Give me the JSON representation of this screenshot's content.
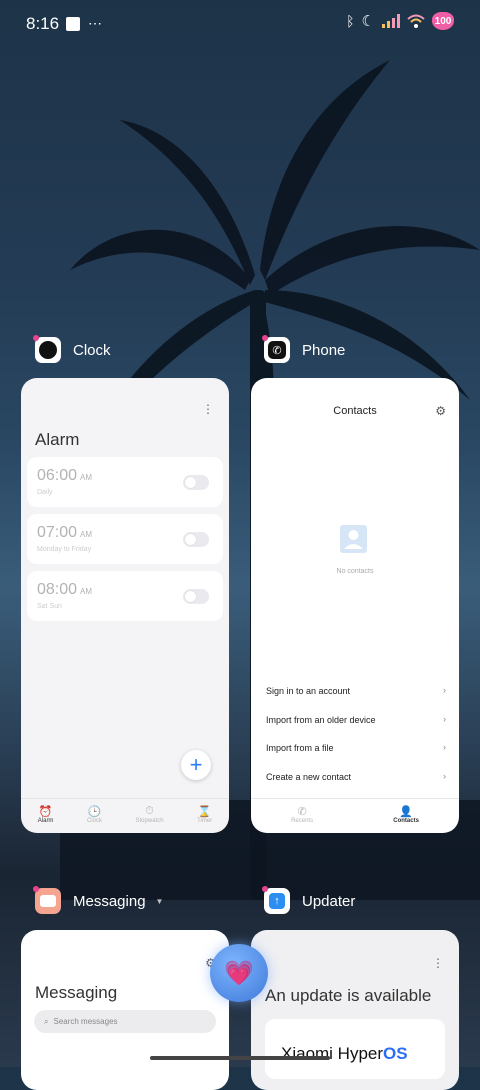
{
  "status": {
    "time": "8:16",
    "battery": "100",
    "battery_color": "#f05fa6"
  },
  "apps": {
    "clock": {
      "name": "Clock",
      "screen_title": "Alarm",
      "alarms": [
        {
          "time": "06:00",
          "ampm": "AM",
          "repeat": "Daily"
        },
        {
          "time": "07:00",
          "ampm": "AM",
          "repeat": "Monday to Friday"
        },
        {
          "time": "08:00",
          "ampm": "AM",
          "repeat": "Sat Sun"
        }
      ],
      "nav": [
        "Alarm",
        "Clock",
        "Stopwatch",
        "Timer"
      ]
    },
    "phone": {
      "name": "Phone",
      "screen_title": "Contacts",
      "empty_text": "No contacts",
      "options": [
        "Sign in to an account",
        "Import from an older device",
        "Import from a file",
        "Create a new contact"
      ],
      "nav": [
        "Recents",
        "Contacts"
      ]
    },
    "messaging": {
      "name": "Messaging",
      "screen_title": "Messaging",
      "search_placeholder": "Search messages"
    },
    "updater": {
      "name": "Updater",
      "screen_title": "An update is available",
      "brand_prefix": "Xiaomi Hyper",
      "brand_suffix": "OS"
    }
  },
  "accent_color": "#2b7ff7"
}
